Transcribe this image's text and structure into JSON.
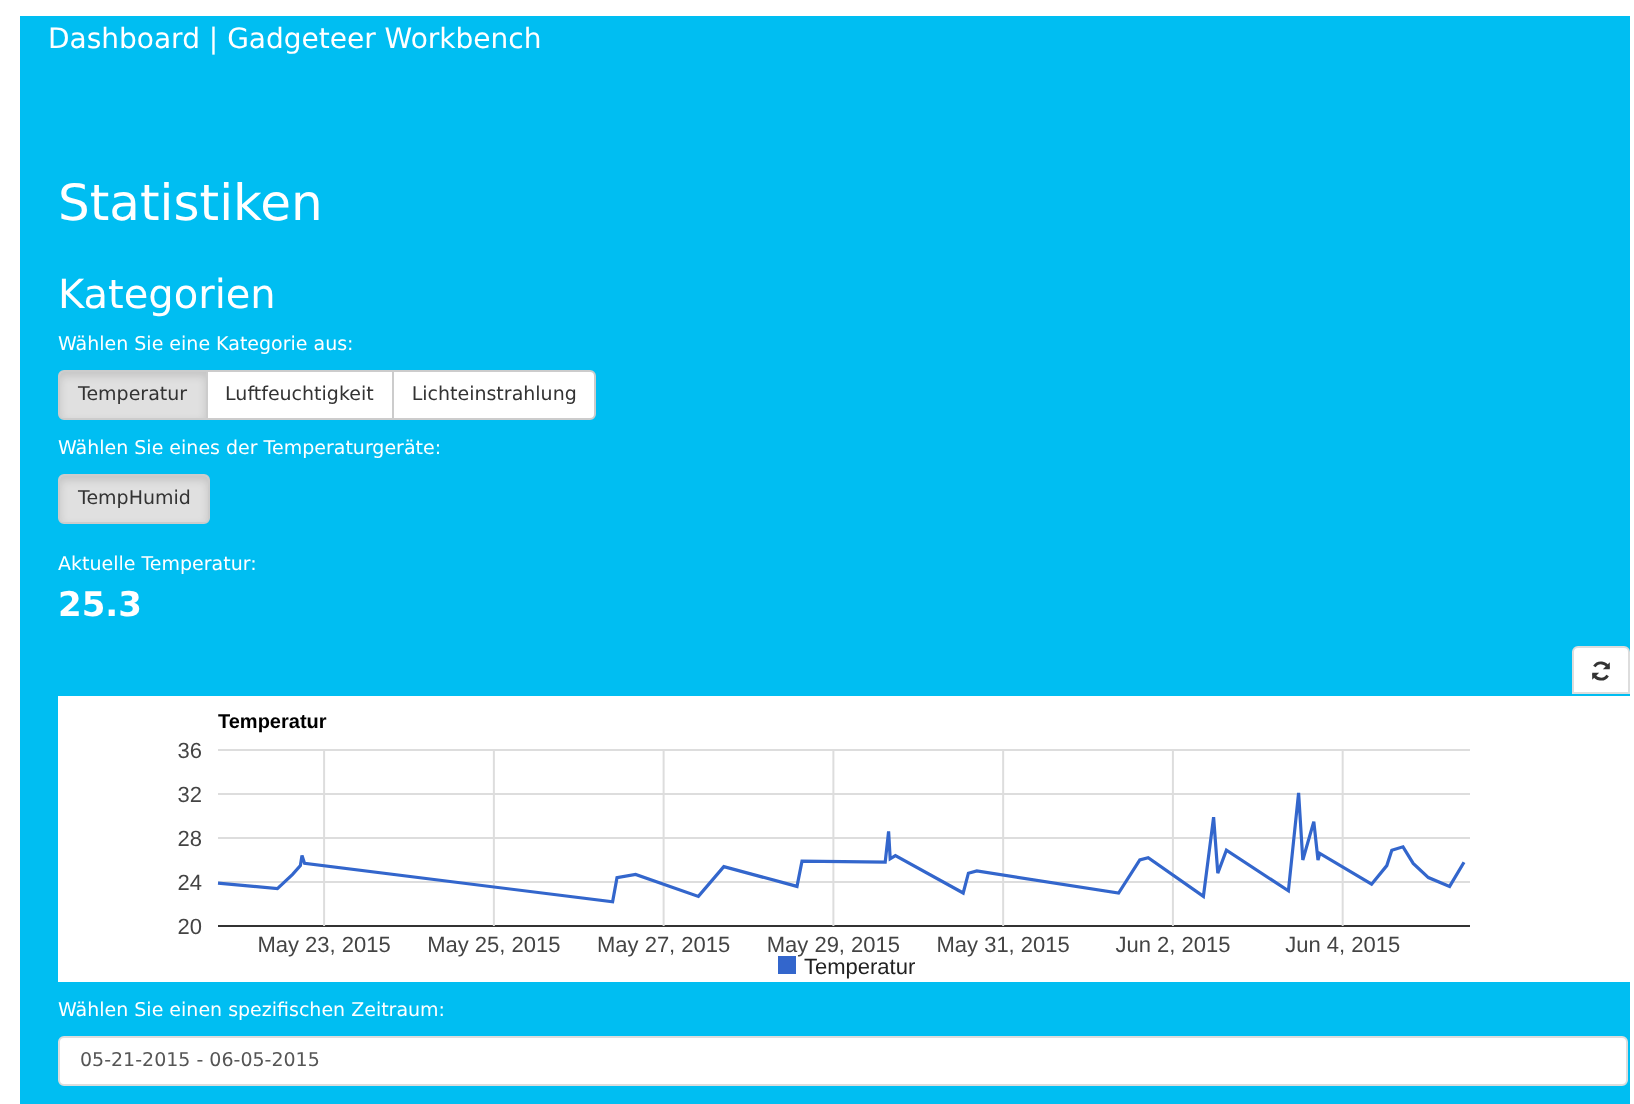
{
  "header": {
    "title": "Dashboard | Gadgeteer Workbench"
  },
  "page_title": "Statistiken",
  "section_title": "Kategorien",
  "category_prompt": "Wählen Sie eine Kategorie aus:",
  "categories": [
    {
      "label": "Temperatur",
      "selected": true
    },
    {
      "label": "Luftfeuchtigkeit",
      "selected": false
    },
    {
      "label": "Lichteinstrahlung",
      "selected": false
    }
  ],
  "device_prompt": "Wählen Sie eines der Temperaturgeräte:",
  "devices": [
    {
      "label": "TempHumid",
      "selected": true
    }
  ],
  "current_label": "Aktuelle Temperatur:",
  "current_value": "25.3",
  "chart": {
    "chart_data": {
      "type": "line",
      "title": "Temperatur",
      "x": [
        "2015-05-21T18:00",
        "2015-05-22T10:48",
        "2015-05-22T15:07",
        "2015-05-22T17:17",
        "2015-05-22T17:46",
        "2015-05-22T18:29",
        "2015-05-26T09:36",
        "2015-05-26T10:48",
        "2015-05-26T16:05",
        "2015-05-27T09:50",
        "2015-05-27T17:02",
        "2015-05-28T13:41",
        "2015-05-28T15:07",
        "2015-05-29T14:38",
        "2015-05-29T15:36",
        "2015-05-29T16:05",
        "2015-05-29T17:31",
        "2015-05-30T12:43",
        "2015-05-30T14:10",
        "2015-05-30T16:34",
        "2015-06-01T08:38",
        "2015-06-01T14:38",
        "2015-06-01T17:02",
        "2015-06-02T08:38",
        "2015-06-02T11:31",
        "2015-06-02T12:43",
        "2015-06-02T15:07",
        "2015-06-03T08:38",
        "2015-06-03T11:31",
        "2015-06-03T12:43",
        "2015-06-03T15:50",
        "2015-06-03T17:02",
        "2015-06-03T17:31",
        "2015-06-04T08:10",
        "2015-06-04T12:29",
        "2015-06-04T13:55",
        "2015-06-04T17:02",
        "2015-06-04T19:55",
        "2015-06-05T00:14",
        "2015-06-05T06:14",
        "2015-06-05T10:19"
      ],
      "series": [
        {
          "name": "Temperatur",
          "color": "#3366cc",
          "values": [
            23.9,
            23.4,
            24.7,
            25.5,
            26.4,
            25.7,
            22.2,
            24.4,
            24.7,
            22.7,
            25.4,
            23.6,
            25.9,
            25.8,
            28.6,
            26.1,
            26.4,
            23.0,
            24.8,
            25.0,
            23.0,
            26.0,
            26.2,
            22.7,
            29.9,
            24.8,
            26.9,
            23.2,
            32.1,
            26.0,
            29.5,
            26.0,
            26.6,
            23.8,
            25.5,
            26.9,
            27.2,
            25.7,
            24.4,
            23.6,
            25.8
          ]
        }
      ],
      "xlim": [
        "2015-05-21T18:00",
        "2015-06-05T12:00"
      ],
      "ylim": [
        20,
        36
      ],
      "xticks": [
        {
          "value": "2015-05-23",
          "label": "May 23, 2015"
        },
        {
          "value": "2015-05-25",
          "label": "May 25, 2015"
        },
        {
          "value": "2015-05-27",
          "label": "May 27, 2015"
        },
        {
          "value": "2015-05-29",
          "label": "May 29, 2015"
        },
        {
          "value": "2015-05-31",
          "label": "May 31, 2015"
        },
        {
          "value": "2015-06-02",
          "label": "Jun 2, 2015"
        },
        {
          "value": "2015-06-04",
          "label": "Jun 4, 2015"
        }
      ],
      "yticks": [
        20,
        24,
        28,
        32,
        36
      ],
      "grid": true
    }
  },
  "range_prompt": "Wählen Sie einen spezifischen Zeitraum:",
  "range_field": {
    "value": "05-21-2015 - 06-05-2015"
  }
}
